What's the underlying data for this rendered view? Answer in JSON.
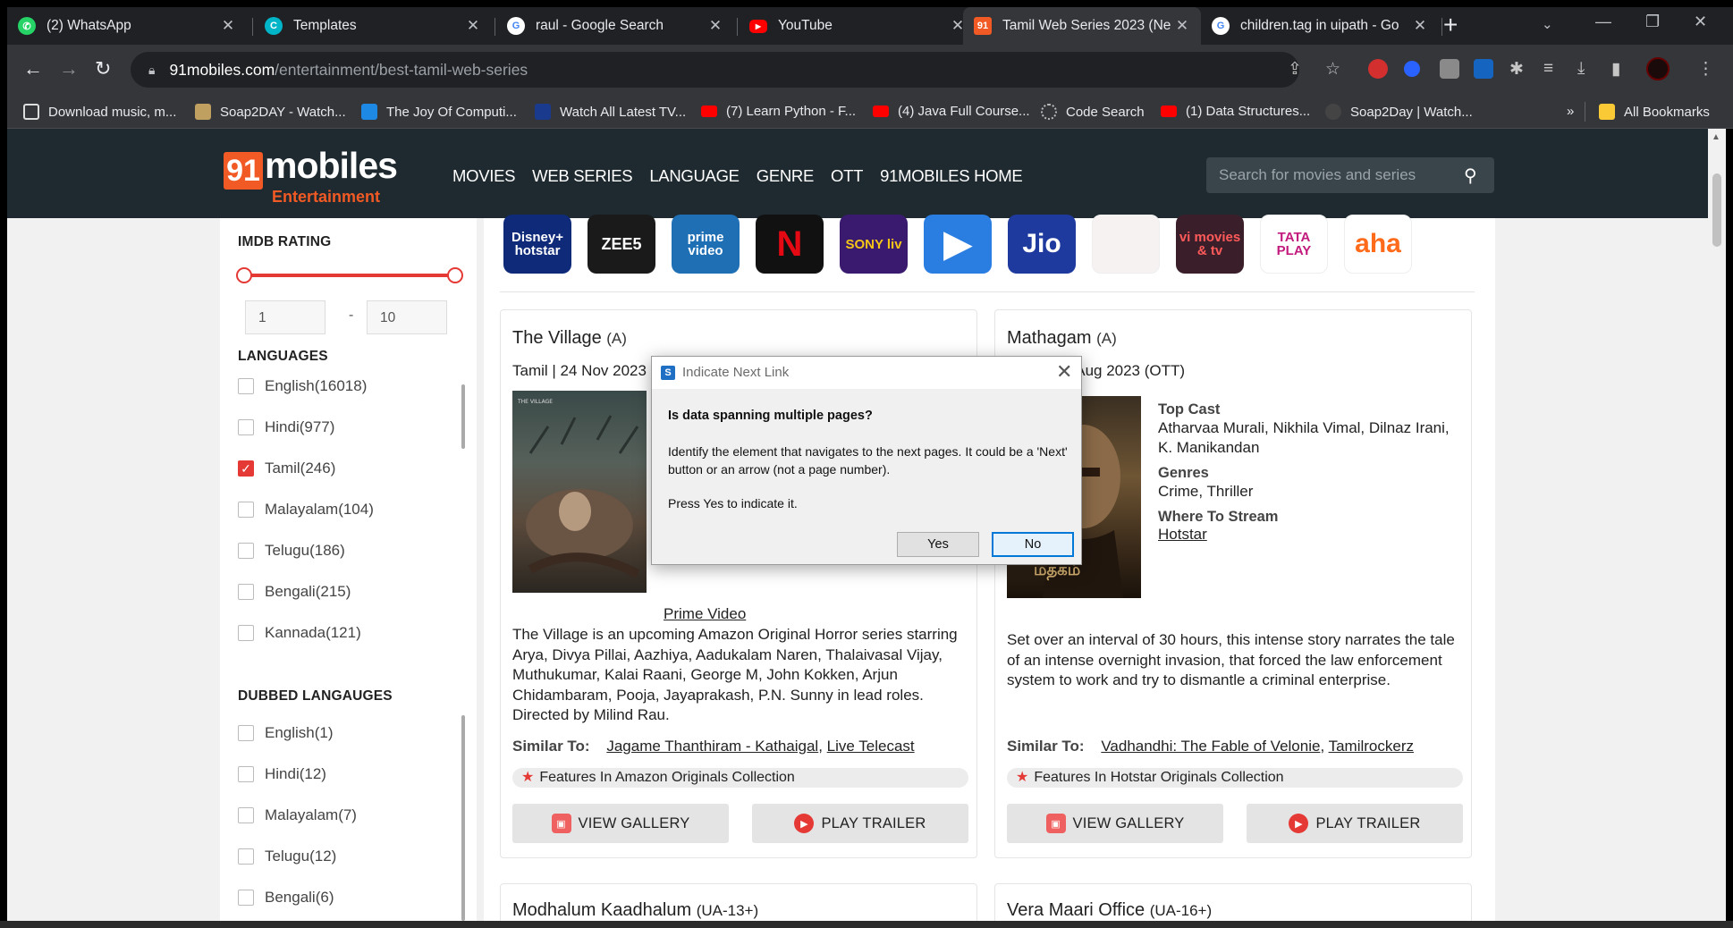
{
  "browser": {
    "tabs": [
      {
        "title": "(2) WhatsApp",
        "icon": "whatsapp-icon",
        "color": "#25d366"
      },
      {
        "title": "Templates",
        "icon": "canva-icon",
        "color": "#00c4cc"
      },
      {
        "title": "raul - Google Search",
        "icon": "google-icon",
        "color": "#ffffff"
      },
      {
        "title": "YouTube",
        "icon": "youtube-icon",
        "color": "#ff0000"
      },
      {
        "title": "Tamil Web Series 2023 (Ne",
        "icon": "91mobiles-icon",
        "color": "#f15a24"
      },
      {
        "title": "children.tag in uipath - Go",
        "icon": "google-icon",
        "color": "#ffffff"
      }
    ],
    "url_host": "91mobiles.com",
    "url_path": "/entertainment/best-tamil-web-series",
    "bookmarks": [
      "Download music, m...",
      "Soap2DAY - Watch...",
      "The Joy Of Computi...",
      "Watch All Latest TV...",
      "(7) Learn Python - F...",
      "(4) Java Full Course...",
      "Code Search",
      "(1) Data Structures...",
      "Soap2Day | Watch..."
    ],
    "bookmarks_overflow": "»",
    "all_bookmarks": "All Bookmarks"
  },
  "site": {
    "logo_91": "91",
    "logo_word": "mobiles",
    "logo_sub": "Entertainment",
    "nav": [
      "MOVIES",
      "WEB SERIES",
      "LANGUAGE",
      "GENRE",
      "OTT",
      "91MOBILES HOME"
    ],
    "search_placeholder": "Search for movies and series"
  },
  "sidebar": {
    "imdb_heading": "IMDB RATING",
    "imdb_min": "1",
    "imdb_max": "10",
    "range_dash": "-",
    "languages_heading": "LANGUAGES",
    "languages": [
      {
        "label": "English(16018)",
        "checked": false
      },
      {
        "label": "Hindi(977)",
        "checked": false
      },
      {
        "label": "Tamil(246)",
        "checked": true
      },
      {
        "label": "Malayalam(104)",
        "checked": false
      },
      {
        "label": "Telugu(186)",
        "checked": false
      },
      {
        "label": "Bengali(215)",
        "checked": false
      },
      {
        "label": "Kannada(121)",
        "checked": false
      }
    ],
    "dubbed_heading": "DUBBED LANGAUGES",
    "dubbed": [
      {
        "label": "English(1)",
        "checked": false
      },
      {
        "label": "Hindi(12)",
        "checked": false
      },
      {
        "label": "Malayalam(7)",
        "checked": false
      },
      {
        "label": "Telugu(12)",
        "checked": false
      },
      {
        "label": "Bengali(6)",
        "checked": false
      }
    ]
  },
  "ott_logos": [
    {
      "name": "disney-hotstar-logo",
      "text": "Disney+ hotstar",
      "bg": "#0e2a78",
      "fg": "#ffffff"
    },
    {
      "name": "zee5-logo",
      "text": "ZEE5",
      "bg": "#1a1a1a",
      "fg": "#ffffff"
    },
    {
      "name": "prime-video-logo",
      "text": "prime video",
      "bg": "#1f6fb5",
      "fg": "#ffffff"
    },
    {
      "name": "netflix-logo",
      "text": "N",
      "bg": "#111111",
      "fg": "#e50914"
    },
    {
      "name": "sonyliv-logo",
      "text": "SONY liv",
      "bg": "#3a1a6e",
      "fg": "#f5c518"
    },
    {
      "name": "mx-player-logo",
      "text": "▶",
      "bg": "#2a7de1",
      "fg": "#ffffff"
    },
    {
      "name": "jio-logo",
      "text": "Jio",
      "bg": "#1f3a9e",
      "fg": "#ffffff"
    },
    {
      "name": "hoichoi-logo",
      "text": "",
      "bg": "#f7f2f2",
      "fg": "#c33"
    },
    {
      "name": "vi-movies-logo",
      "text": "vi movies & tv",
      "bg": "#3a1f2a",
      "fg": "#ff5a5a"
    },
    {
      "name": "tata-play-logo",
      "text": "TATA PLAY",
      "bg": "#ffffff",
      "fg": "#c21a7d"
    },
    {
      "name": "aha-logo",
      "text": "aha",
      "bg": "#ffffff",
      "fg": "#ff6b1a"
    }
  ],
  "cards": [
    {
      "title": "The Village",
      "rating": "(A)",
      "meta": "Tamil | 24 Nov 2023",
      "stream_partial": "Prime Video",
      "description": "The Village is an upcoming Amazon Original Horror series starring Arya, Divya Pillai, Aazhiya, Aadukalam Naren, Thalaivasal Vijay, Muthukumar, Kalai Raani, George M, John Kokken, Arjun Chidambaram, Pooja, Jayaprakash, P.N. Sunny in lead roles. Directed by Milind Rau.",
      "similar_label": "Similar To:",
      "similar": [
        "Jagame Thanthiram - Kathaigal",
        "Live Telecast"
      ],
      "feature": "Features In Amazon Originals Collection",
      "btn_gallery": "VIEW GALLERY",
      "btn_trailer": "PLAY TRAILER"
    },
    {
      "title": "Mathagam",
      "rating": "(A)",
      "meta": "Tamil | 18 Aug 2023 (OTT)",
      "cast_label": "Top Cast",
      "cast": "Atharvaa Murali, Nikhila Vimal, Dilnaz Irani, K. Manikandan",
      "genres_label": "Genres",
      "genres": "Crime, Thriller",
      "stream_label": "Where To Stream",
      "stream": "Hotstar",
      "description": "Set over an interval of 30 hours, this intense story narrates the tale of an intense overnight invasion, that forced the law enforcement system to work and try to dismantle a criminal enterprise.",
      "similar_label": "Similar To:",
      "similar": [
        "Vadhandhi: The Fable of Velonie",
        "Tamilrockerz"
      ],
      "feature": "Features In Hotstar Originals Collection",
      "btn_gallery": "VIEW GALLERY",
      "btn_trailer": "PLAY TRAILER"
    }
  ],
  "next_cards": [
    {
      "title": "Modhalum Kaadhalum",
      "rating": "(UA-13+)"
    },
    {
      "title": "Vera Maari Office",
      "rating": "(UA-16+)"
    }
  ],
  "dialog": {
    "title": "Indicate Next Link",
    "question": "Is data spanning multiple pages?",
    "body": "Identify the element that navigates to the next pages. It could be a 'Next' button or an arrow (not a page number).",
    "prompt": "Press Yes to indicate it.",
    "yes": "Yes",
    "no": "No"
  }
}
